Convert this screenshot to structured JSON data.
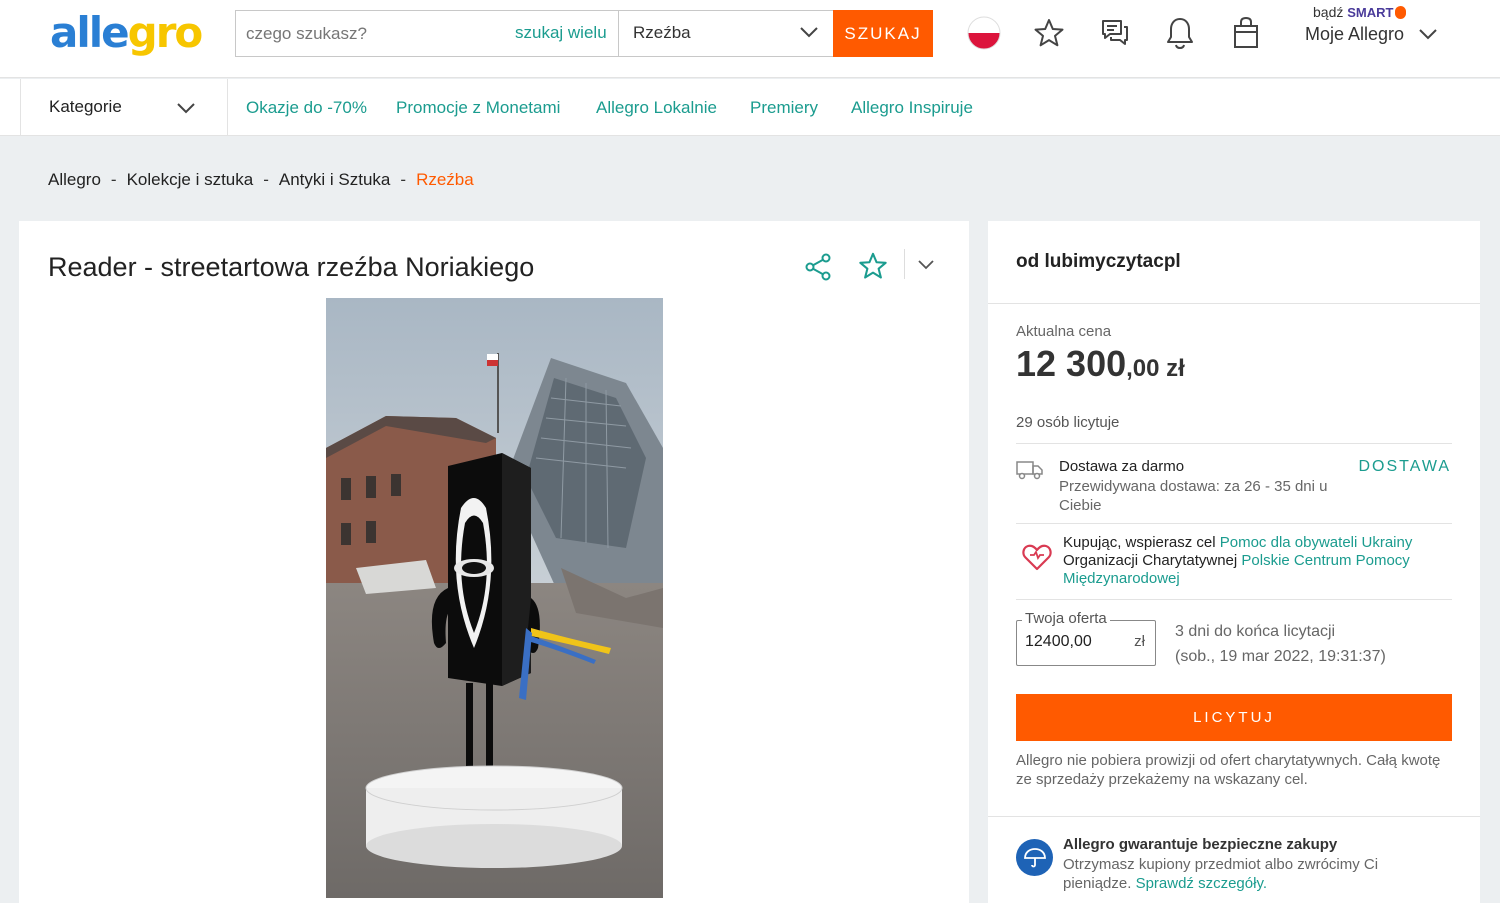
{
  "header": {
    "logo_part1": "alle",
    "logo_part2": "gro",
    "search_placeholder": "czego szukasz?",
    "search_many": "szukaj wielu",
    "category_selected": "Rzeźba",
    "search_button": "SZUKAJ",
    "smart_prefix": "bądź",
    "smart_label": "SMART",
    "account_label": "Moje Allegro"
  },
  "nav": {
    "categories_label": "Kategorie",
    "links": [
      "Okazje do -70%",
      "Promocje z Monetami",
      "Allegro Lokalnie",
      "Premiery",
      "Allegro Inspiruje"
    ]
  },
  "breadcrumb": {
    "items": [
      "Allegro",
      "Kolekcje i sztuka",
      "Antyki i Sztuka"
    ],
    "current": "Rzeźba",
    "separator": "-"
  },
  "product": {
    "title": "Reader - streetartowa rzeźba Noriakiego"
  },
  "offer": {
    "seller": "od lubimyczytacpl",
    "price_label": "Aktualna cena",
    "price_main": "12 300",
    "price_decimals": ",00 zł",
    "bidders": "29 osób licytuje",
    "delivery_title": "Dostawa za darmo",
    "delivery_sub": "Przewidywana dostawa: za 26 - 35 dni u Ciebie",
    "delivery_link": "DOSTAWA",
    "charity_text1": "Kupując, wspierasz cel ",
    "charity_link1": "Pomoc dla obywateli Ukrainy",
    "charity_text2": " Organizacji Charytatywnej ",
    "charity_link2": "Polskie Centrum Pomocy Międzynarodowej",
    "your_offer_label": "Twoja oferta",
    "your_offer_value": "12400,00",
    "your_offer_unit": "zł",
    "ends_in": "3 dni do końca licytacji",
    "ends_date": "(sob., 19 mar 2022, 19:31:37)",
    "bid_button": "LICYTUJ",
    "note": "Allegro nie pobiera prowizji od ofert charytatywnych. Całą kwotę ze sprzedaży przekażemy na wskazany cel.",
    "guarantee_title": "Allegro gwarantuje bezpieczne zakupy",
    "guarantee_text": "Otrzymasz kupiony przedmiot albo zwrócimy Ci pieniądze. ",
    "guarantee_link": "Sprawdź szczegóły."
  },
  "colors": {
    "accent": "#ff5a00",
    "link": "#1b9c8f",
    "background": "#eceff1"
  },
  "icons": [
    "poland-flag-icon",
    "star-icon",
    "messages-icon",
    "bell-icon",
    "bag-icon",
    "chevron-down-icon",
    "share-icon",
    "truck-icon",
    "heart-icon",
    "umbrella-icon"
  ]
}
